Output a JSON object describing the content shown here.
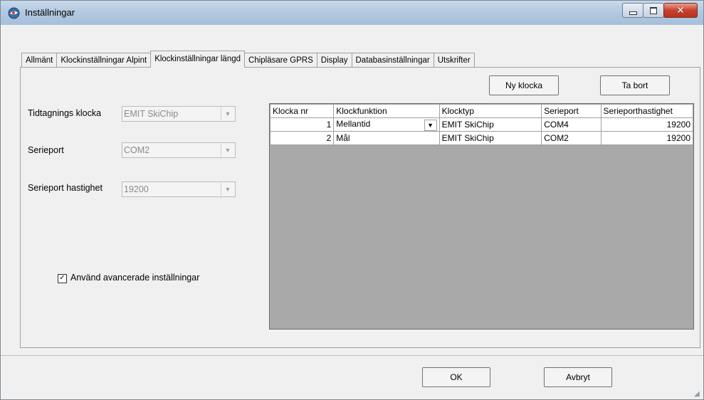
{
  "window": {
    "title": "Inställningar"
  },
  "tabs": [
    {
      "label": "Allmänt",
      "active": false
    },
    {
      "label": "Klockinställningar Alpint",
      "active": false
    },
    {
      "label": "Klockinställningar längd",
      "active": true
    },
    {
      "label": "Chipläsare GPRS",
      "active": false
    },
    {
      "label": "Display",
      "active": false
    },
    {
      "label": "Databasinställningar",
      "active": false
    },
    {
      "label": "Utskrifter",
      "active": false
    }
  ],
  "form": {
    "timing_clock_label": "Tidtagnings klocka",
    "timing_clock_value": "EMIT SkiChip",
    "serial_port_label": "Serieport",
    "serial_port_value": "COM2",
    "serial_speed_label": "Serieport hastighet",
    "serial_speed_value": "19200",
    "advanced_label": "Använd avancerade inställningar",
    "advanced_checked": true
  },
  "buttons": {
    "new_clock": "Ny klocka",
    "delete": "Ta bort",
    "ok": "OK",
    "cancel": "Avbryt"
  },
  "table": {
    "headers": [
      "Klocka nr",
      "Klockfunktion",
      "Klocktyp",
      "Serieport",
      "Serieporthastighet"
    ],
    "rows": [
      {
        "nr": "1",
        "function": "Mellantid",
        "type": "EMIT SkiChip",
        "port": "COM4",
        "speed": "19200"
      },
      {
        "nr": "2",
        "function": "Mål",
        "type": "EMIT SkiChip",
        "port": "COM2",
        "speed": "19200"
      }
    ]
  }
}
